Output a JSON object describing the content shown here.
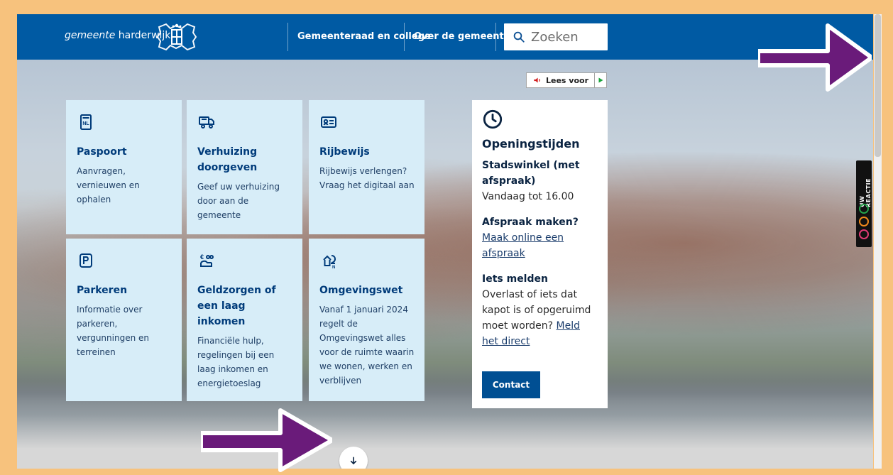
{
  "header": {
    "brand_italic": "gemeente",
    "brand_rest": " harderwijk",
    "nav": [
      {
        "label": "Gemeenteraad en college"
      },
      {
        "label": "Over de gemeente"
      }
    ],
    "search": {
      "label": "Zoeken"
    }
  },
  "readbar": {
    "label": "Lees voor"
  },
  "tiles": [
    {
      "title": "Paspoort",
      "desc": "Aanvragen, vernieuwen en ophalen",
      "icon": "passport-icon"
    },
    {
      "title": "Verhuizing doorgeven",
      "desc": "Geef uw verhuizing door aan de gemeente",
      "icon": "moving-truck-icon"
    },
    {
      "title": "Rijbewijs",
      "desc": "Rijbewijs verlengen? Vraag het digitaal aan",
      "icon": "drivers-license-icon"
    },
    {
      "title": "Parkeren",
      "desc": "Informatie over parkeren, vergunningen en terreinen",
      "icon": "parking-icon"
    },
    {
      "title": "Geldzorgen of een laag inkomen",
      "desc": "Financiële hulp, regelingen bij een laag inkomen en energietoeslag",
      "icon": "money-help-icon"
    },
    {
      "title": "Omgevingswet",
      "desc": "Vanaf 1 januari 2024 regelt de Omgevingswet alles voor de ruimte waarin we wonen, werken en verblijven",
      "icon": "environment-law-icon"
    }
  ],
  "hours": {
    "title": "Openingstijden",
    "stadswinkel_title": "Stadswinkel (met afspraak)",
    "stadswinkel_text": "Vandaag tot 16.00",
    "afspraak_title": "Afspraak maken?",
    "afspraak_link": "Maak online een afspraak",
    "melden_title": "Iets melden",
    "melden_text": "Overlast of iets dat kapot is of opgeruimd moet worden?",
    "melden_link": "Meld het direct",
    "contact_button": "Contact"
  },
  "feedback": {
    "label": "UW REACTIE"
  }
}
